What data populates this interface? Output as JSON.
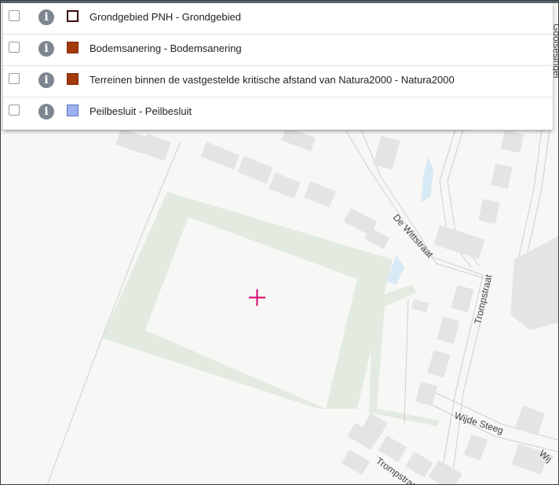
{
  "layers": [
    {
      "label": "Grondgebied PNH - Grondgebied",
      "swatch_fill": "#ffffff",
      "swatch_border": "#3a0a0a",
      "checked": false
    },
    {
      "label": "Bodemsanering - Bodemsanering",
      "swatch_fill": "#a33a0c",
      "swatch_border": "#7a2a08",
      "checked": false
    },
    {
      "label": "Terreinen binnen de vastgestelde kritische afstand van Natura2000 - Natura2000",
      "swatch_fill": "#a33a0c",
      "swatch_border": "#7a2a08",
      "checked": false
    },
    {
      "label": "Peilbesluit - Peilbesluit",
      "swatch_fill": "#9db3f0",
      "swatch_border": "#5a6fc0",
      "checked": false
    }
  ],
  "info_icon_glyph": "i",
  "map": {
    "streets": {
      "de_wittstraat": "De Wittstraat",
      "trompstraat": "Trompstraat",
      "wijde_steeg": "Wijde Steeg",
      "trompstraat_bottom": "Trompstraa",
      "edge_right_top": "Gooisesingel",
      "edge_right_bottom": "Wij"
    },
    "colors": {
      "background": "#f7f7f5",
      "building": "#e4e4e4",
      "green": "#e3ebe1",
      "water": "#d6e9f5",
      "road_line": "#d0d0d0",
      "crosshair": "#d4006e"
    }
  }
}
